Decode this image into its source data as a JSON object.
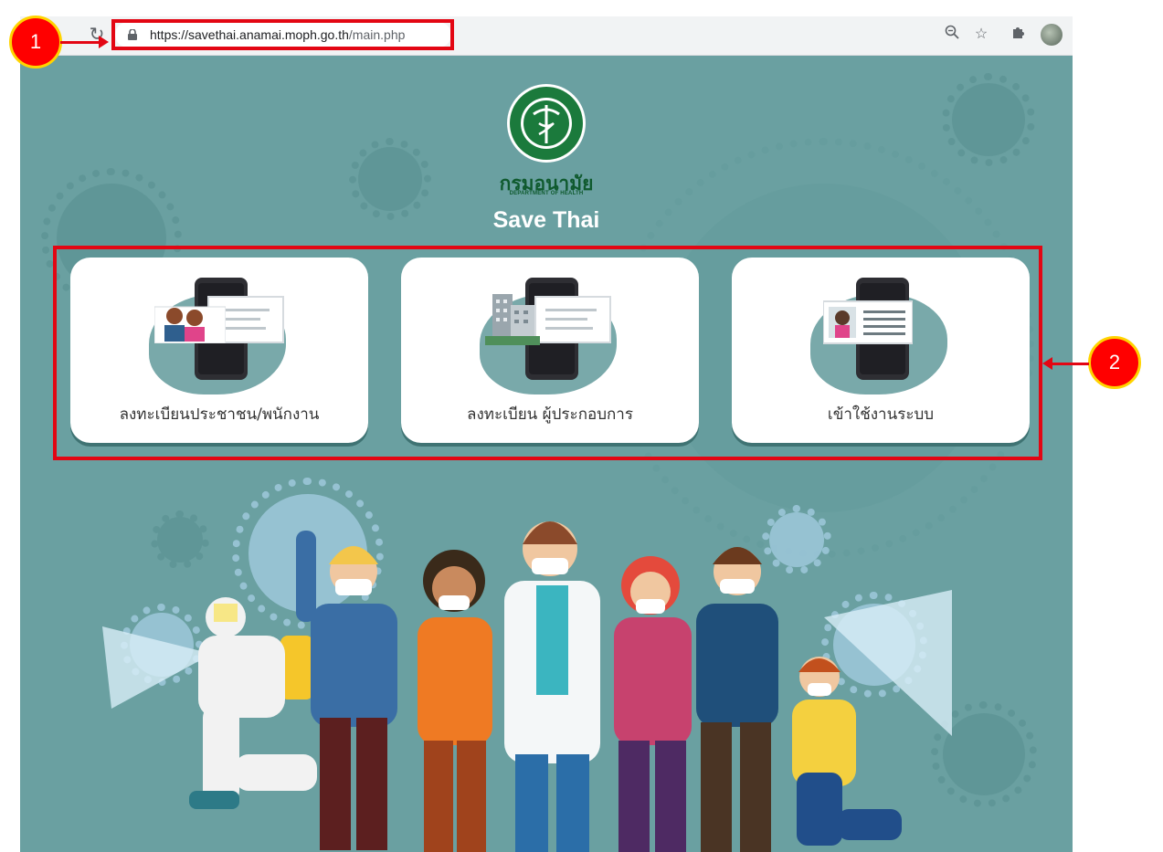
{
  "browser": {
    "url_host": "https://savethai.anamai.moph.go.th",
    "url_path": "/main.php",
    "reload_icon": "reload-icon",
    "lock_icon": "lock-icon",
    "toolbar_icons": [
      "zoom-icon",
      "star-icon",
      "extensions-icon",
      "profile-avatar"
    ]
  },
  "header": {
    "org_name_thai": "กรมอนามัย",
    "org_name_en": "DEPARTMENT OF HEALTH",
    "title": "Save Thai",
    "logo": "ministry-of-public-health-seal"
  },
  "cards": [
    {
      "label": "ลงทะเบียนประชาชน/พนักงาน",
      "icon": "people-registration-icon"
    },
    {
      "label": "ลงทะเบียน ผู้ประกอบการ",
      "icon": "business-registration-icon"
    },
    {
      "label": "เข้าใช้งานระบบ",
      "icon": "login-icon"
    }
  ],
  "annotations": {
    "marker_1": "1",
    "marker_2": "2",
    "highlight_color": "#e30613"
  },
  "colors": {
    "page_background": "#6aa0a1",
    "card_background": "#ffffff",
    "title_text": "#ffffff",
    "org_text": "#0f5a2e"
  }
}
